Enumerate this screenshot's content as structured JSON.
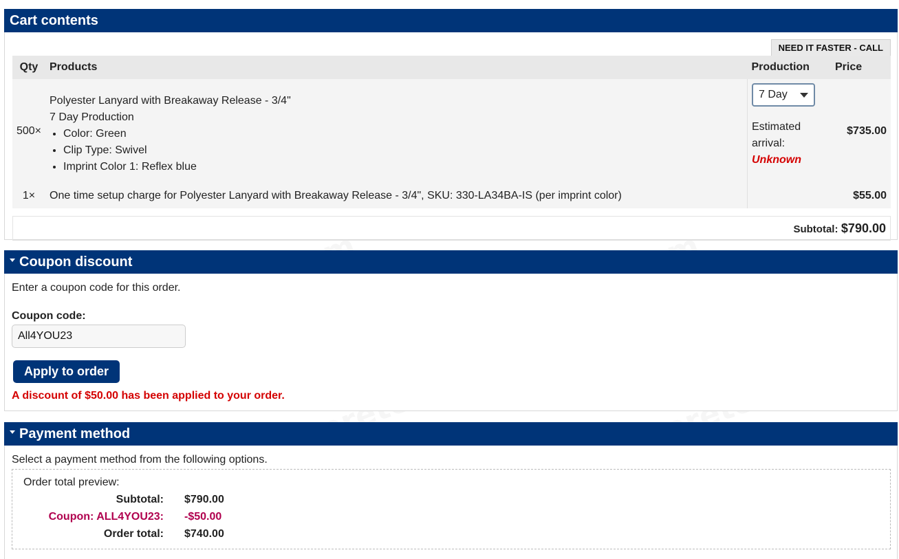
{
  "cart": {
    "title": "Cart contents",
    "faster_label": "NEED IT FASTER - CALL",
    "columns": {
      "qty": "Qty",
      "products": "Products",
      "production": "Production",
      "price": "Price"
    },
    "items": [
      {
        "qty": "500×",
        "name": "Polyester Lanyard with Breakaway Release - 3/4\"",
        "production_line": "7 Day Production",
        "options": [
          "Color: Green",
          "Clip Type: Swivel",
          "Imprint Color 1: Reflex blue"
        ],
        "production_select": "7 Day",
        "estimated_label_1": "Estimated",
        "estimated_label_2": "arrival:",
        "estimated_value": "Unknown",
        "price": "$735.00"
      },
      {
        "qty": "1×",
        "name": "One time setup charge for Polyester Lanyard with Breakaway Release - 3/4\", SKU: 330-LA34BA-IS (per imprint color)",
        "price": "$55.00"
      }
    ],
    "subtotal_label": "Subtotal:",
    "subtotal_value": "$790.00"
  },
  "coupon": {
    "title": "Coupon discount",
    "description": "Enter a coupon code for this order.",
    "field_label": "Coupon code:",
    "field_value": "All4YOU23",
    "apply_button": "Apply to order",
    "message": "A discount of $50.00 has been applied to your order."
  },
  "payment": {
    "title": "Payment method",
    "description": "Select a payment method from the following options.",
    "preview_title": "Order total preview:",
    "rows": [
      {
        "label": "Subtotal:",
        "value": "$790.00"
      },
      {
        "label": "Coupon: ALL4YOU23:",
        "value": "-$50.00"
      },
      {
        "label": "Order total:",
        "value": "$740.00"
      }
    ]
  },
  "colors": {
    "header": "#003478",
    "alert": "#d40000",
    "coupon": "#b0004e"
  }
}
